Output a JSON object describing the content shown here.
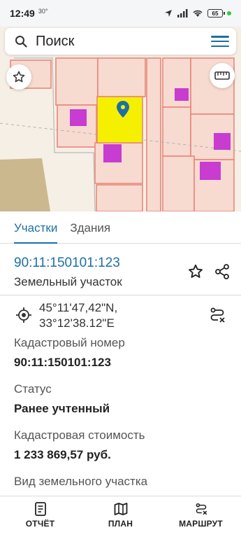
{
  "status_bar": {
    "time": "12:49",
    "temp": "30°",
    "battery": "65"
  },
  "search": {
    "placeholder": "Поиск"
  },
  "tabs": [
    {
      "label": "Участки",
      "active": true
    },
    {
      "label": "Здания",
      "active": false
    }
  ],
  "parcel": {
    "number": "90:11:150101:123",
    "type": "Земельный участок"
  },
  "coordinates": {
    "lat": "45°11'47,42\"N,",
    "lon": "33°12'38.12\"E"
  },
  "info": [
    {
      "label": "Кадастровый номер",
      "value": "90:11:150101:123"
    },
    {
      "label": "Статус",
      "value": "Ранее учтенный"
    },
    {
      "label": "Кадастровая стоимость",
      "value": "1 233 869,57 руб."
    },
    {
      "label": "Вид земельного участка",
      "value": ""
    }
  ],
  "bottom_nav": {
    "report": "ОТЧЁТ",
    "plan": "ПЛАН",
    "route": "МАРШРУТ"
  },
  "colors": {
    "accent": "#1d6fa5",
    "parcel_highlight": "#f5f000",
    "building": "#c83cd0",
    "parcel_border": "#e8877a",
    "parcel_fill": "#f7d9cf"
  },
  "icons": {
    "search": "search-icon",
    "menu": "hamburger-menu-icon",
    "star": "star-icon",
    "ruler": "ruler-icon",
    "pin": "location-pin-icon",
    "share": "share-icon",
    "target": "crosshair-target-icon",
    "route": "route-icon",
    "report": "document-icon",
    "plan": "map-icon"
  }
}
